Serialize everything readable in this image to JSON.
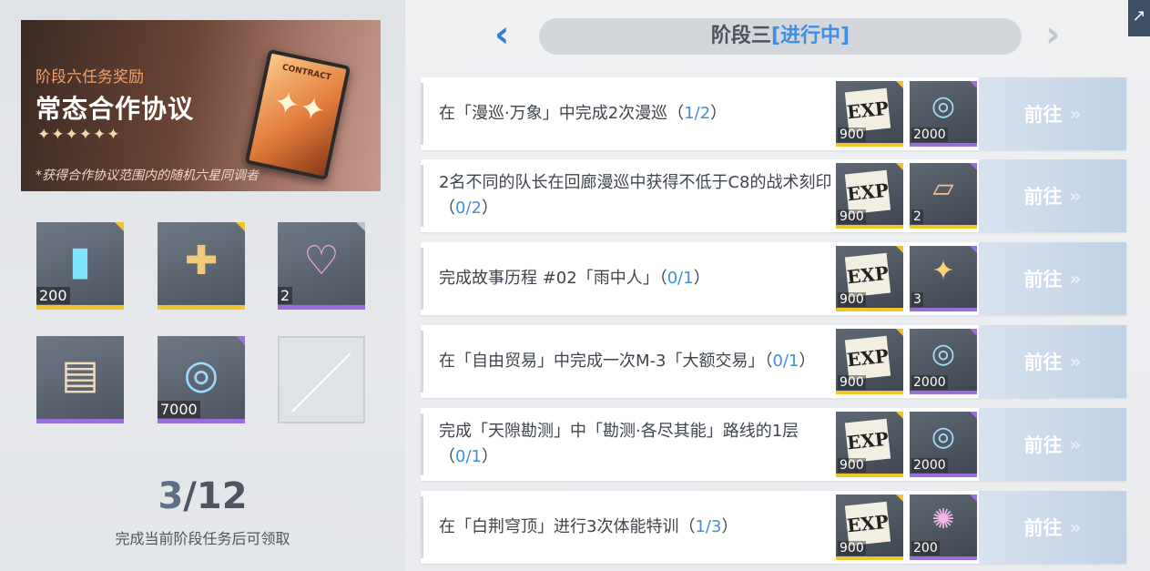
{
  "reward_panel": {
    "subtitle": "阶段六任务奖励",
    "title": "常态合作协议",
    "stars": "✦✦✦✦✦✦",
    "note": "*获得合作协议范围内的随机六星同调者",
    "card_text": "CONTRACT",
    "card_glyph": "✦✦"
  },
  "items": [
    {
      "count": "200",
      "icon": "bottle-icon",
      "rarity_color": "#f0c52a"
    },
    {
      "count": "",
      "icon": "card-icon",
      "rarity_color": "#f0c52a"
    },
    {
      "count": "2",
      "icon": "heart-crystal-icon",
      "rarity_color": "#9b6ee0"
    },
    {
      "count": "",
      "icon": "package-icon",
      "rarity_color": "#9b6ee0"
    },
    {
      "count": "7000",
      "icon": "coin-icon",
      "rarity_color": "#9b6ee0"
    },
    {
      "count": "",
      "icon": "empty-slot-icon",
      "rarity_color": ""
    }
  ],
  "progress": {
    "current": "3",
    "separator": "/",
    "total": "12",
    "hint": "完成当前阶段任务后可领取"
  },
  "stage": {
    "title": "阶段三",
    "status": "[进行中]",
    "prev": "‹",
    "next": "›"
  },
  "corner_button": "↗",
  "go_label": "前往",
  "go_arrow": "»",
  "tasks": [
    {
      "text_before": "在「漫巡·万象」中完成2次漫巡（",
      "done": "1",
      "slash": "/",
      "total": "2",
      "text_after": "）",
      "rewards": [
        {
          "icon": "exp-icon",
          "amount": "900",
          "color": "#f0c52a"
        },
        {
          "icon": "coin-icon",
          "amount": "2000",
          "color": "#9b6ee0"
        }
      ]
    },
    {
      "text_before": "2名不同的队长在回廊漫巡中获得不低于C8的战术刻印（",
      "done": "0",
      "slash": "/",
      "total": "2",
      "text_after": "）",
      "rewards": [
        {
          "icon": "exp-icon",
          "amount": "900",
          "color": "#f0c52a"
        },
        {
          "icon": "snack-icon",
          "amount": "2",
          "color": "#f0c52a"
        }
      ]
    },
    {
      "text_before": "完成故事历程 #02「雨中人」（",
      "done": "0",
      "slash": "/",
      "total": "1",
      "text_after": "）",
      "rewards": [
        {
          "icon": "exp-icon",
          "amount": "900",
          "color": "#f0c52a"
        },
        {
          "icon": "crystal-card-icon",
          "amount": "3",
          "color": "#9b6ee0"
        }
      ]
    },
    {
      "text_before": "在「自由贸易」中完成一次M-3「大额交易」（",
      "done": "0",
      "slash": "/",
      "total": "1",
      "text_after": "）",
      "rewards": [
        {
          "icon": "exp-icon",
          "amount": "900",
          "color": "#f0c52a"
        },
        {
          "icon": "coin-icon",
          "amount": "2000",
          "color": "#9b6ee0"
        }
      ]
    },
    {
      "text_before": "完成「天隙勘测」中「勘测·各尽其能」路线的1层（",
      "done": "0",
      "slash": "/",
      "total": "1",
      "text_after": "）",
      "rewards": [
        {
          "icon": "exp-icon",
          "amount": "900",
          "color": "#f0c52a"
        },
        {
          "icon": "coin-icon",
          "amount": "2000",
          "color": "#9b6ee0"
        }
      ]
    },
    {
      "text_before": "在「白荆穹顶」进行3次体能特训（",
      "done": "1",
      "slash": "/",
      "total": "3",
      "text_after": "）",
      "rewards": [
        {
          "icon": "exp-icon",
          "amount": "900",
          "color": "#f0c52a"
        },
        {
          "icon": "gear-disc-icon",
          "amount": "200",
          "color": "#9b6ee0"
        }
      ]
    }
  ]
}
